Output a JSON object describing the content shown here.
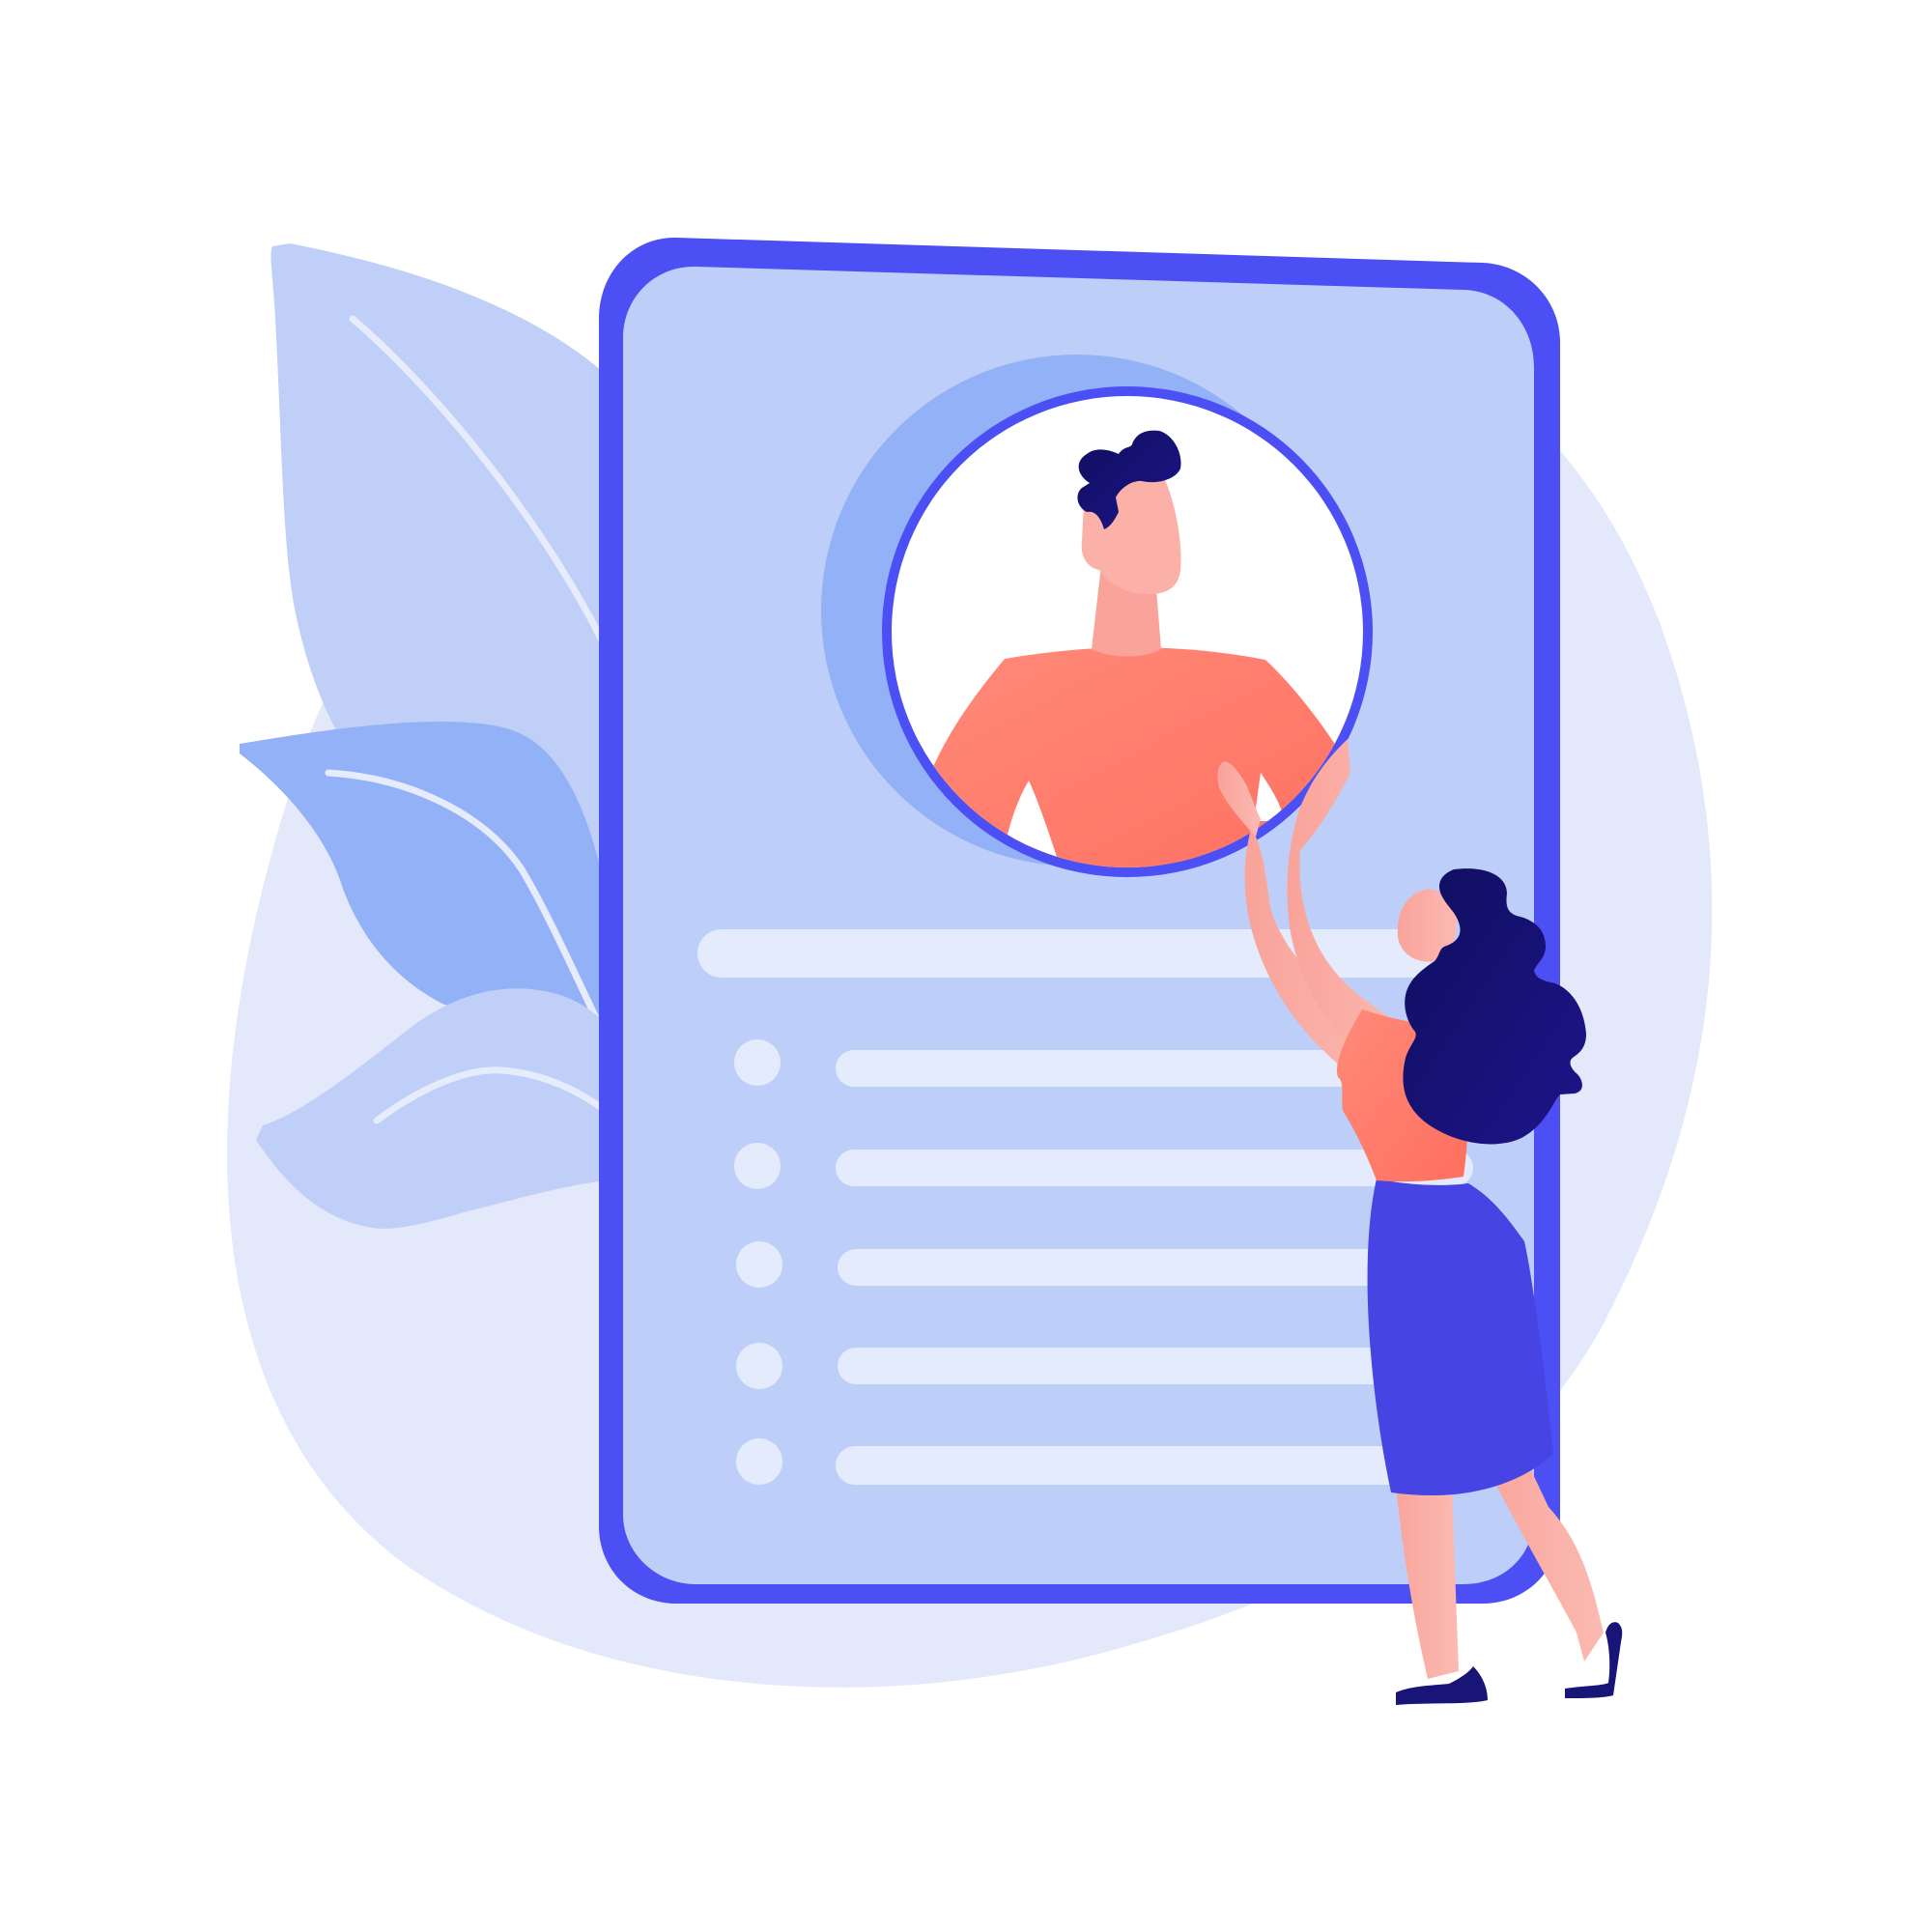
{
  "illustration": {
    "subject": "profile-card",
    "colors": {
      "background": "#ffffff",
      "blob": "#e3e9fb",
      "leaf_light": "#bfcff8",
      "leaf_mid": "#93b1f6",
      "leaf_vein": "#e6ecfc",
      "device_frame": "#4b4ff4",
      "screen": "#bdcff9",
      "avatar_shadow": "#93b1f6",
      "avatar_bg": "#ffffff",
      "skin": "#fbb1a8",
      "shirt": "#ff7566",
      "hair": "#181478",
      "skirt": "#4645e4",
      "text_line": "#e4ebfd",
      "bullet": "#e4ebfd"
    },
    "list_items_count": 5,
    "icons": [
      "user-avatar-icon",
      "bullet-icon"
    ]
  }
}
